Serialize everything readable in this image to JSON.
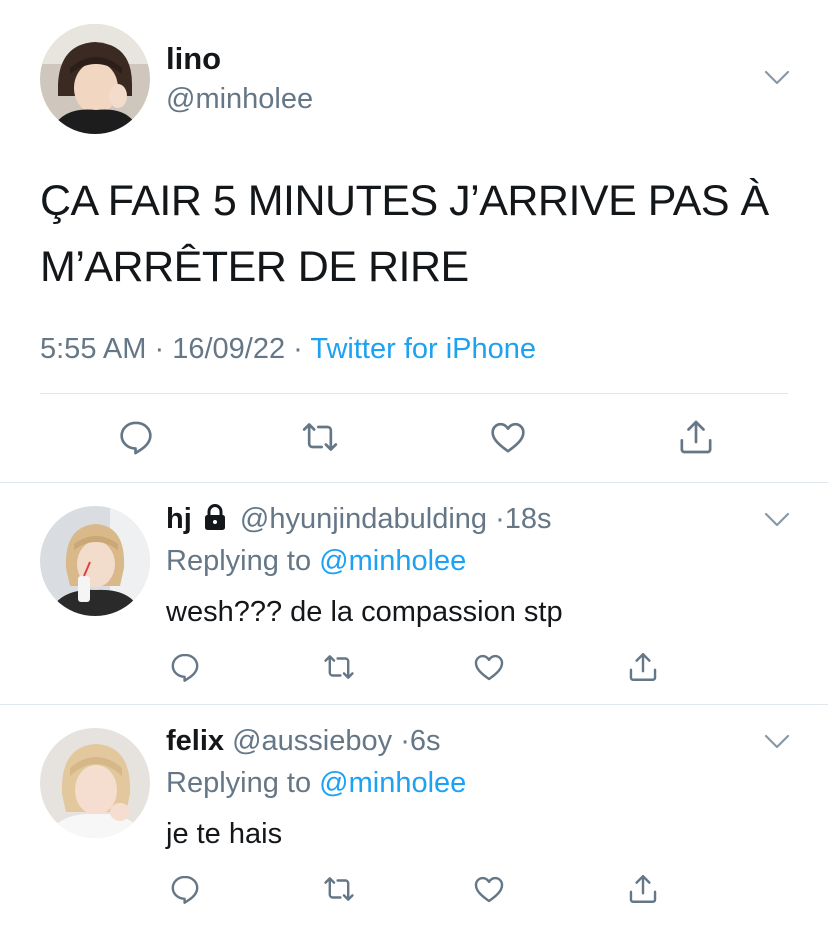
{
  "main_tweet": {
    "name": "lino",
    "handle": "@minholee",
    "text_line1": "ÇA FAIR 5 MINUTES J’ARRIVE PAS À",
    "text_line2": "M’ARRÊTER DE RIRE",
    "time": "5:55 AM",
    "date": "16/09/22",
    "source": "Twitter for iPhone",
    "sep": "·"
  },
  "replies": [
    {
      "name": "hj",
      "locked": true,
      "handle": "@hyunjindabulding",
      "dot": "·",
      "age": "18s",
      "replying_label": "Replying to",
      "replying_to": "@minholee",
      "text": "wesh??? de la compassion stp"
    },
    {
      "name": "felix",
      "locked": false,
      "handle": "@aussieboy",
      "dot": "·",
      "age": "6s",
      "replying_label": "Replying to",
      "replying_to": "@minholee",
      "text": "je te hais"
    }
  ],
  "icons": [
    "chevron-down-icon",
    "reply-icon",
    "retweet-icon",
    "like-icon",
    "share-icon",
    "lock-icon"
  ],
  "colors": {
    "accent": "#1da1f2",
    "secondary_text": "#657786",
    "icon": "#657786",
    "divider": "#e1e8ed"
  }
}
